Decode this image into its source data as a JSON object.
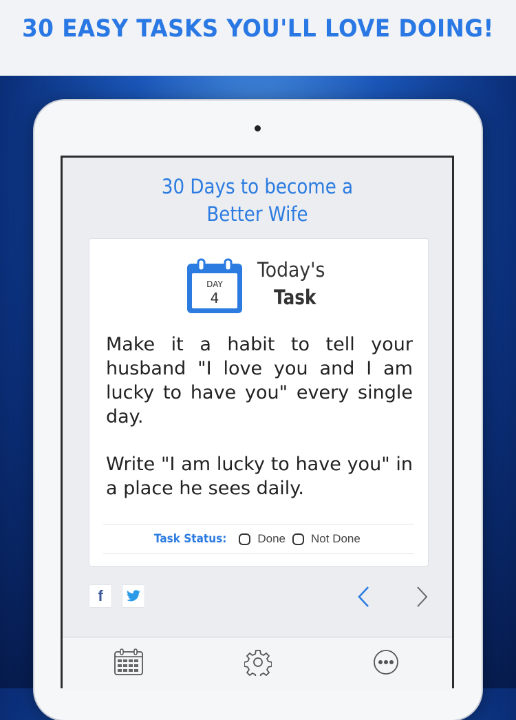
{
  "promo": {
    "headline": "30 EASY TASKS YOU'LL LOVE DOING!"
  },
  "app": {
    "title_line1": "30 Days to become a",
    "title_line2": "Better Wife"
  },
  "task_card": {
    "calendar": {
      "day_label": "DAY",
      "day_number": "4",
      "icon": "calendar-icon"
    },
    "today_label": "Today's",
    "task_label": "Task",
    "paragraphs": [
      "Make it a habit to tell your husband \"I love you and I am lucky to have you\" every single day.",
      "Write \"I am lucky to have you\" in a place he sees daily."
    ],
    "status": {
      "label": "Task Status:",
      "option_done": "Done",
      "option_not_done": "Not Done"
    }
  },
  "share": {
    "facebook_glyph": "f",
    "twitter_icon": "twitter-icon"
  },
  "nav": {
    "prev_icon": "chevron-left-icon",
    "next_icon": "chevron-right-icon"
  },
  "tabbar": {
    "items": [
      "calendar-grid-icon",
      "gear-icon",
      "more-icon"
    ]
  },
  "colors": {
    "accent": "#2b7be0",
    "headline": "#2a78e4",
    "calendar": "#2b7be0"
  }
}
